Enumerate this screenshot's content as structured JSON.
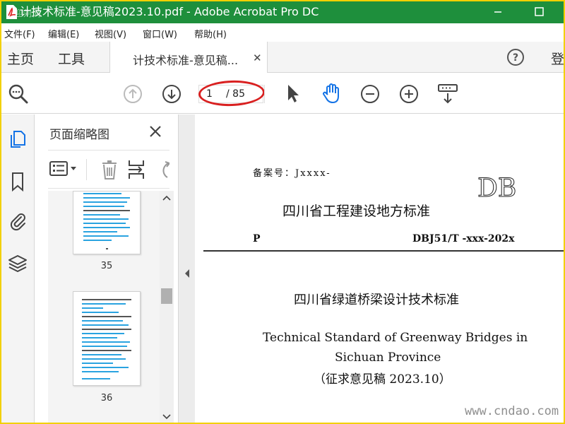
{
  "window": {
    "title": "计技术标准-意见稿2023.10.pdf - Adobe Acrobat Pro DC",
    "overlay_mark": "迎刘网"
  },
  "menu": {
    "items": [
      "文件(F)",
      "编辑(E)",
      "视图(V)",
      "窗口(W)",
      "帮助(H)"
    ]
  },
  "tabs": {
    "home": "主页",
    "tools": "工具",
    "document": "计技术标准-意见稿...",
    "login": "登"
  },
  "toolbar": {
    "current_page": "1",
    "total_pages": "/ 85"
  },
  "thumbnails": {
    "panel_title": "页面缩略图",
    "pages": [
      {
        "number": "35"
      },
      {
        "number": "36"
      }
    ]
  },
  "document": {
    "filing": "备案号：Jxxxx-",
    "db_mark": "DB",
    "org_title": "四川省工程建设地方标准",
    "p_code": "P",
    "std_code": "DBJ51/T -xxx-202x",
    "cn_title": "四川省绿道桥梁设计技术标准",
    "en_title_1": "Technical Standard of Greenway Bridges in",
    "en_title_2": "Sichuan Province",
    "draft": "（征求意见稿 2023.10）"
  },
  "watermark": "www.cndao.com",
  "colors": {
    "titlebar": "#1e8f3c",
    "accent_blue": "#1473e6",
    "annotation_red": "#d92020",
    "frame_yellow": "#f2d000"
  }
}
